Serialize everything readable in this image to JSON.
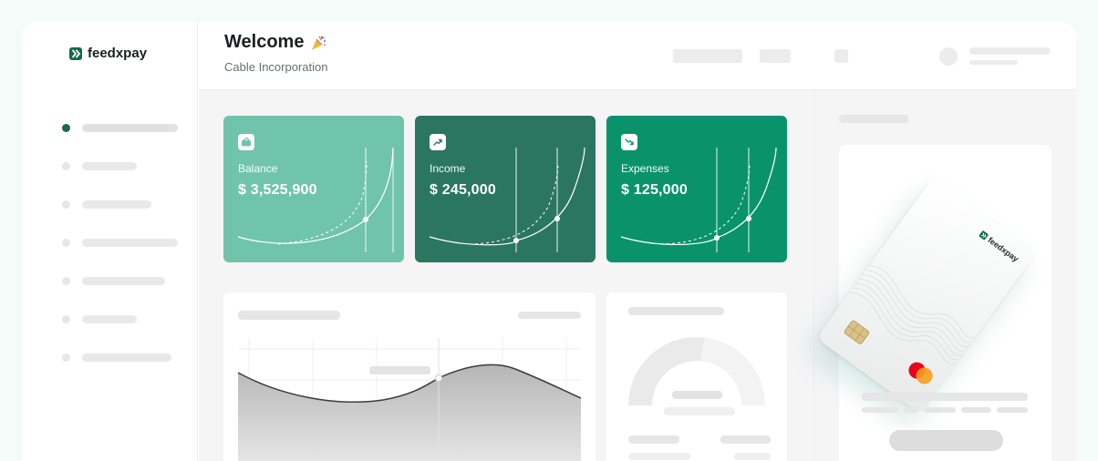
{
  "brand": {
    "name": "feedxpay",
    "logo_icon": "feedxpay-logo-icon",
    "color": "#136a4c"
  },
  "header": {
    "title": "Welcome",
    "title_icon": "party-popper-icon",
    "subtitle": "Cable Incorporation"
  },
  "cards": [
    {
      "label": "Balance",
      "value": "$ 3,525,900",
      "icon": "wallet-icon",
      "color": "#71c4ac"
    },
    {
      "label": "Income",
      "value": "$ 245,000",
      "icon": "trend-up-icon",
      "color": "#2b7660"
    },
    {
      "label": "Expenses",
      "value": "$ 125,000",
      "icon": "trend-down-icon",
      "color": "#0a936b"
    }
  ],
  "payment_card": {
    "brand_text": "feedxpay",
    "network_icon": "mastercard-icon",
    "chip_icon": "chip-icon"
  }
}
